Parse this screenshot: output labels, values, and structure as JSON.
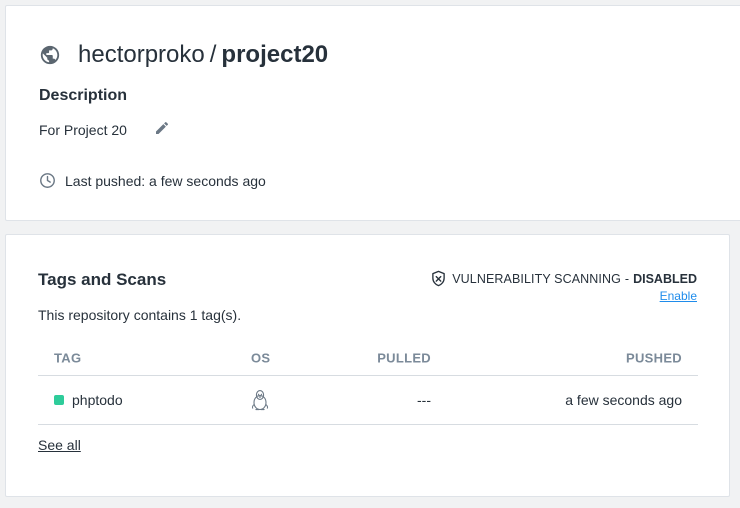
{
  "repo": {
    "owner": "hectorproko",
    "separator": "/",
    "name": "project20",
    "description_heading": "Description",
    "description": "For Project 20",
    "last_pushed": "Last pushed: a few seconds ago",
    "icons": {
      "title": "globe-icon",
      "edit": "pencil-icon",
      "pushed": "clock-icon"
    }
  },
  "tags_section": {
    "heading": "Tags and Scans",
    "vulnerability": {
      "label": "VULNERABILITY SCANNING",
      "dash": "-",
      "status": "DISABLED",
      "enable_link": "Enable",
      "icon": "shield-x-icon"
    },
    "count_text": "This repository contains 1 tag(s).",
    "columns": [
      "TAG",
      "OS",
      "PULLED",
      "PUSHED"
    ],
    "rows": [
      {
        "tag": "phptodo",
        "tag_color": "#2ecc9a",
        "os_icon": "linux-tux-icon",
        "pulled": "---",
        "pushed": "a few seconds ago"
      }
    ],
    "see_all": "See all"
  },
  "colors": {
    "background": "#f1f2f3",
    "card": "#ffffff",
    "text": "#27313b",
    "muted": "#7b8a99",
    "link": "#1f8ceb"
  }
}
